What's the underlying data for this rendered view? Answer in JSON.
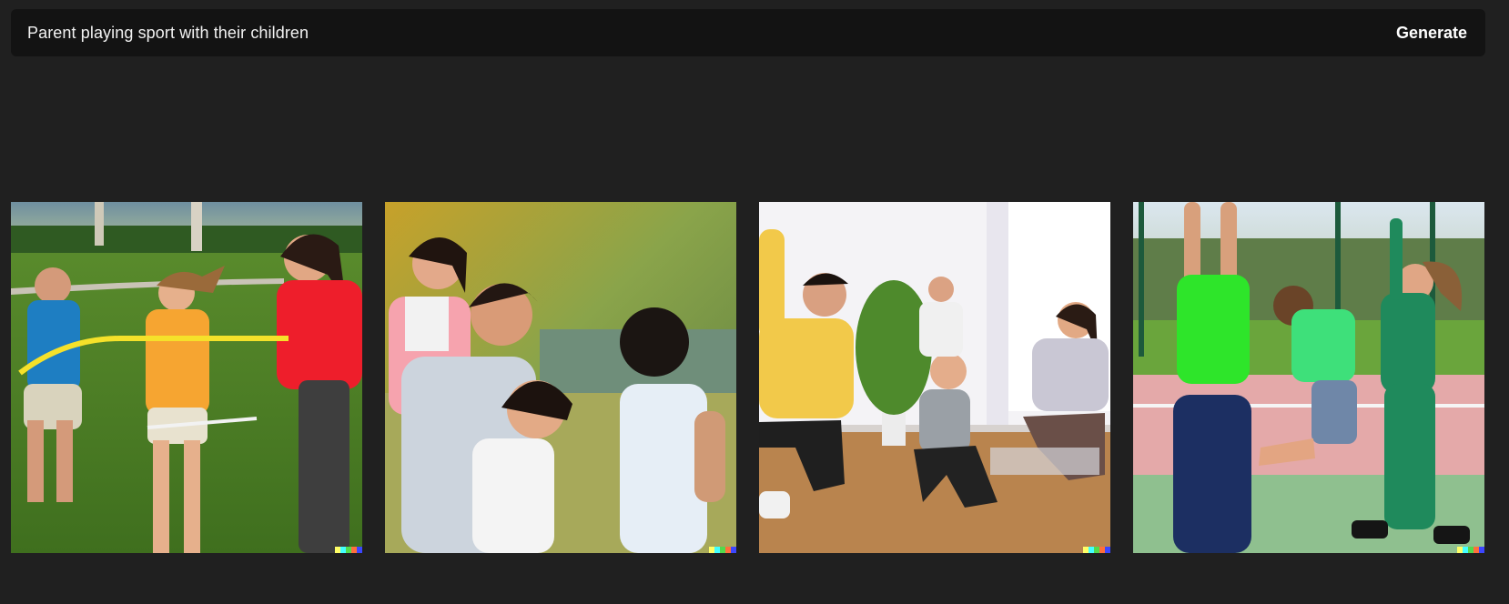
{
  "prompt": {
    "text": "Parent playing sport with their children",
    "generate_label": "Generate"
  },
  "images": [
    {
      "subject": "family tug-of-war in a park with a yellow rope"
    },
    {
      "subject": "smiling parent and children in a sunny park"
    },
    {
      "subject": "family stretching on a wooden floor indoors"
    },
    {
      "subject": "family jumping on an outdoor sports court"
    }
  ],
  "signature_colors": [
    "#ffff66",
    "#42ffff",
    "#51da4c",
    "#ff6e3c",
    "#3c46ff"
  ],
  "colors": {
    "page_background": "#202020",
    "prompt_bar_background": "#131313",
    "prompt_text": "#f2f2f2"
  }
}
